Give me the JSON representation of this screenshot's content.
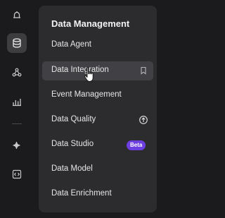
{
  "sidebar": {
    "icons": [
      {
        "name": "bell-icon"
      },
      {
        "name": "database-icon",
        "active": true
      },
      {
        "name": "nodes-icon"
      },
      {
        "name": "bar-chart-icon"
      },
      {
        "name": "sparkle-icon"
      },
      {
        "name": "code-icon"
      }
    ]
  },
  "menu": {
    "title": "Data Management",
    "items": [
      {
        "label": "Data Agent"
      },
      {
        "label": "Data Integration",
        "hovered": true,
        "trailing_icon": "bookmark-icon"
      },
      {
        "label": "Event Management"
      },
      {
        "label": "Data Quality",
        "trailing_icon": "arrow-up-circle-icon"
      },
      {
        "label": "Data Studio",
        "badge": "Beta"
      },
      {
        "label": "Data Model"
      },
      {
        "label": "Data Enrichment"
      }
    ]
  },
  "colors": {
    "background": "#1b1b1d",
    "panel": "#2c2c2f",
    "hover": "#414145",
    "badge": "#6d3fe0"
  }
}
